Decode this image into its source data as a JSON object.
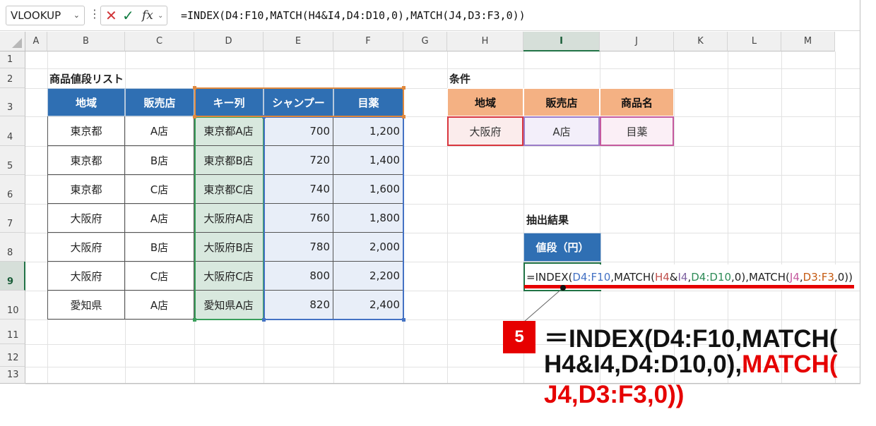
{
  "formula_bar": {
    "name_box": "VLOOKUP",
    "name_box_chevron": "⌄",
    "dots": "⋮",
    "cancel_icon": "✕",
    "enter_icon": "✓",
    "fx_label": "fx",
    "fx_chevron": "⌄",
    "formula": "=INDEX(D4:F10,MATCH(H4&I4,D4:D10,0),MATCH(J4,D3:F3,0))"
  },
  "columns": [
    "A",
    "B",
    "C",
    "D",
    "E",
    "F",
    "G",
    "H",
    "I",
    "J",
    "K",
    "L",
    "M"
  ],
  "selected_column": "I",
  "rows": [
    "1",
    "2",
    "3",
    "4",
    "5",
    "6",
    "7",
    "8",
    "9",
    "10",
    "11",
    "12",
    "13"
  ],
  "selected_row": "9",
  "price_list": {
    "title": "商品値段リスト",
    "headers": [
      "地域",
      "販売店",
      "キー列",
      "シャンプー",
      "目薬"
    ],
    "rows": [
      [
        "東京都",
        "A店",
        "東京都A店",
        "700",
        "1,200"
      ],
      [
        "東京都",
        "B店",
        "東京都B店",
        "720",
        "1,400"
      ],
      [
        "東京都",
        "C店",
        "東京都C店",
        "740",
        "1,600"
      ],
      [
        "大阪府",
        "A店",
        "大阪府A店",
        "760",
        "1,800"
      ],
      [
        "大阪府",
        "B店",
        "大阪府B店",
        "780",
        "2,000"
      ],
      [
        "大阪府",
        "C店",
        "大阪府C店",
        "800",
        "2,200"
      ],
      [
        "愛知県",
        "A店",
        "愛知県A店",
        "820",
        "2,400"
      ]
    ]
  },
  "conditions": {
    "title": "条件",
    "headers": [
      "地域",
      "販売店",
      "商品名"
    ],
    "values": [
      "大阪府",
      "A店",
      "目薬"
    ]
  },
  "result": {
    "title": "抽出結果",
    "header": "値段（円）",
    "formula_parts": [
      {
        "text": "=INDEX(",
        "color": "#222222"
      },
      {
        "text": "D4:F10",
        "color": "#4472c4"
      },
      {
        "text": ",MATCH(",
        "color": "#222222"
      },
      {
        "text": "H4",
        "color": "#c0504d"
      },
      {
        "text": "&",
        "color": "#222222"
      },
      {
        "text": "I4",
        "color": "#8064a2"
      },
      {
        "text": ",",
        "color": "#222222"
      },
      {
        "text": "D4:D10",
        "color": "#2e8b57"
      },
      {
        "text": ",0),MATCH(",
        "color": "#222222"
      },
      {
        "text": "J4",
        "color": "#c55a9e"
      },
      {
        "text": ",",
        "color": "#222222"
      },
      {
        "text": "D3:F3",
        "color": "#c55a11"
      },
      {
        "text": ",0))",
        "color": "#222222"
      }
    ]
  },
  "annotation": {
    "step": "5",
    "line1": "＝INDEX(D4:F10,MATCH(",
    "line2_dark": "H4&I4,D4:D10,0),",
    "line2_red": "MATCH(",
    "line3": "J4,D3:F3,0))"
  },
  "colors": {
    "header_blue": "#2f6fb3",
    "header_orange": "#f4b183",
    "selection_green": "#217346",
    "accent_red": "#e60000"
  }
}
